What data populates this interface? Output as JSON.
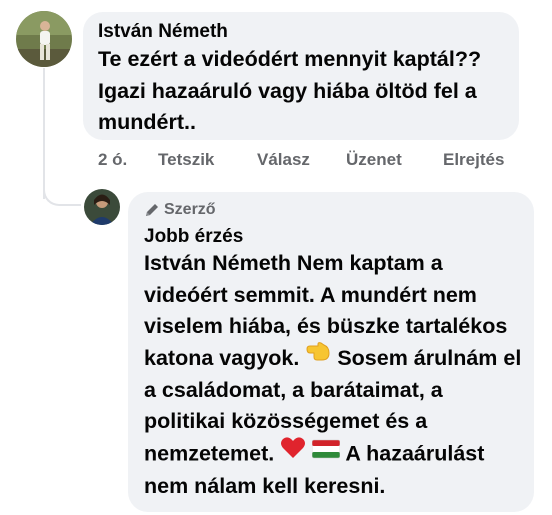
{
  "comment": {
    "author": "István Németh",
    "text": "Te ezért a videódért mennyit kaptál?? Igazi hazaáruló vagy hiába öltöd fel a mundért..",
    "actions": {
      "time": "2 ó.",
      "like": "Tetszik",
      "reply": "Válasz",
      "message": "Üzenet",
      "hide": "Elrejtés"
    }
  },
  "reply": {
    "badge": "Szerző",
    "author": "Jobb érzés",
    "text_part1": "István Németh Nem kaptam a videóért semmit. A mundért nem viselem hiába, és büszke tartalékos katona vagyok.",
    "text_part2": "Sosem árulnám el a családomat, a barátaimat, a politikai közösségemet és a nemzetemet.",
    "text_part3": "A hazaárulást nem nálam kell keresni.",
    "emojis": [
      "pointing-left-emoji",
      "red-heart-emoji",
      "hungary-flag-emoji"
    ]
  },
  "colors": {
    "bubble": "#f0f2f5",
    "meta": "#65676b",
    "text": "#050505",
    "line": "#e2e4e8"
  }
}
